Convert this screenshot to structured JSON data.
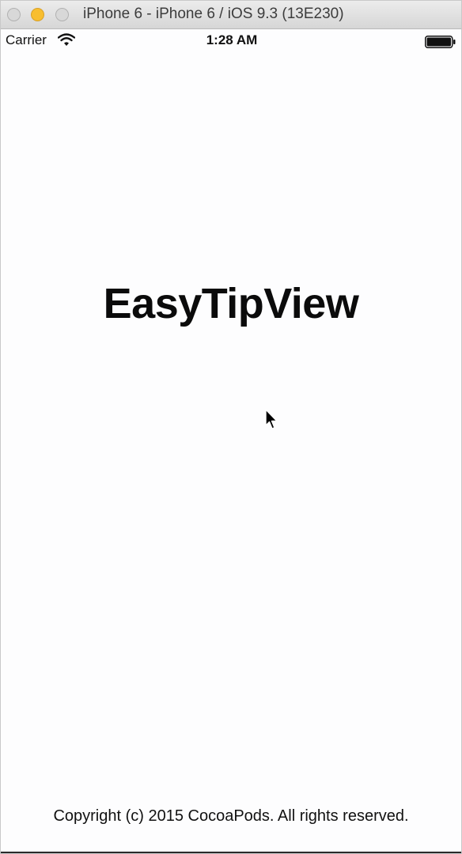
{
  "window": {
    "title": "iPhone 6 - iPhone 6 / iOS 9.3 (13E230)",
    "controls": [
      "close-icon",
      "minimize-icon",
      "zoom-icon"
    ]
  },
  "status_bar": {
    "carrier": "Carrier",
    "time": "1:28 AM",
    "wifi_icon": "wifi-icon",
    "battery_icon": "battery-icon"
  },
  "main": {
    "title": "EasyTipView",
    "cursor_icon": "cursor-arrow-icon"
  },
  "footer": {
    "copyright": "Copyright (c) 2015 CocoaPods. All rights reserved."
  }
}
